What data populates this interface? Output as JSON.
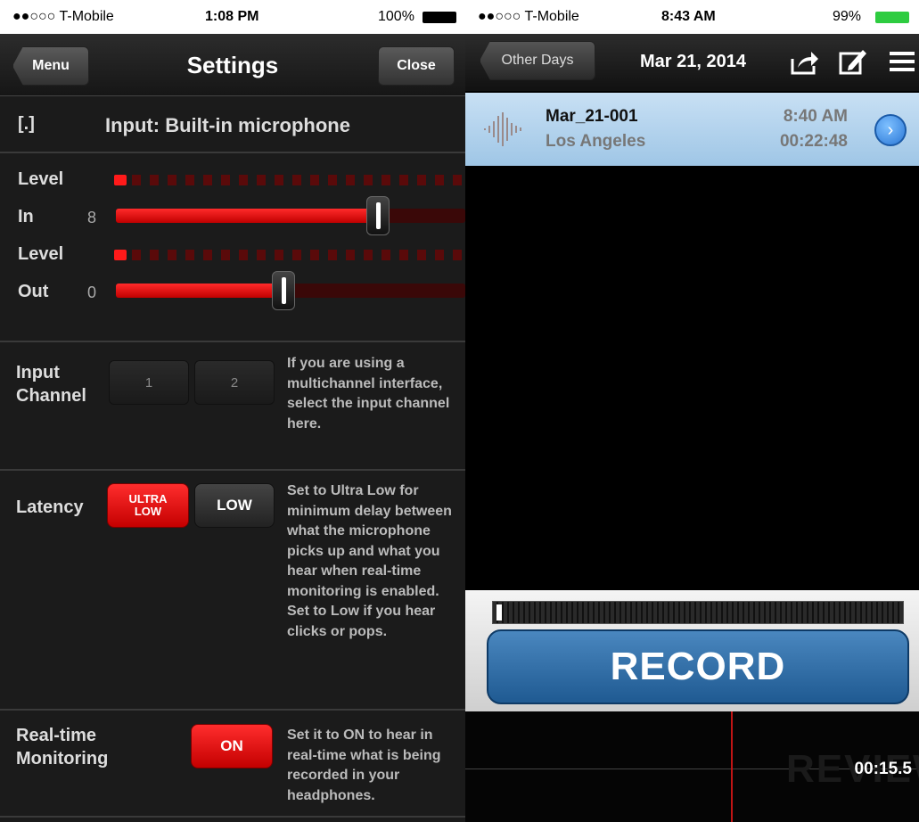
{
  "left": {
    "status": {
      "carrier": "●●○○○ T-Mobile",
      "time": "1:08 PM",
      "battery": "100%"
    },
    "nav": {
      "menu": "Menu",
      "title": "Settings",
      "close": "Close"
    },
    "input": {
      "icon_text": "[.]",
      "label": "Input: Built-in microphone"
    },
    "levels": {
      "level_label": "Level",
      "in_label": "In",
      "in_value": "8",
      "in_fraction": 0.75,
      "out_label": "Out",
      "out_value": "0",
      "out_fraction": 0.48
    },
    "input_channel": {
      "label_line1": "Input",
      "label_line2": "Channel",
      "options": [
        "1",
        "2"
      ],
      "description": "If you are using a multichannel interface, select the input channel here."
    },
    "latency": {
      "label": "Latency",
      "ultra_line1": "ULTRA",
      "ultra_line2": "LOW",
      "low": "LOW",
      "selected": "ULTRA LOW",
      "description": "Set to Ultra Low for minimum delay between what the microphone picks up and what you hear when real-time monitoring is enabled.  Set to Low if you hear clicks or pops."
    },
    "monitoring": {
      "label_line1": "Real-time",
      "label_line2": "Monitoring",
      "toggle": "ON",
      "description": "Set it to ON to hear in real-time what is being recorded in your headphones."
    }
  },
  "right": {
    "status": {
      "carrier": "●●○○○ T-Mobile",
      "time": "8:43 AM",
      "battery": "99%"
    },
    "nav": {
      "back": "Other Days",
      "date": "Mar 21, 2014",
      "icons": [
        "share-icon",
        "edit-icon",
        "list-icon"
      ]
    },
    "recording": {
      "name": "Mar_21-001",
      "location": "Los Angeles",
      "time": "8:40 AM",
      "duration": "00:22:48"
    },
    "record_button": "RECORD",
    "watermark": "REVIEW",
    "timecode": "00:15.5"
  },
  "colors": {
    "accent_red": "#e60000",
    "record_blue": "#2f6da8",
    "row_highlight": "#b7d5ee"
  }
}
